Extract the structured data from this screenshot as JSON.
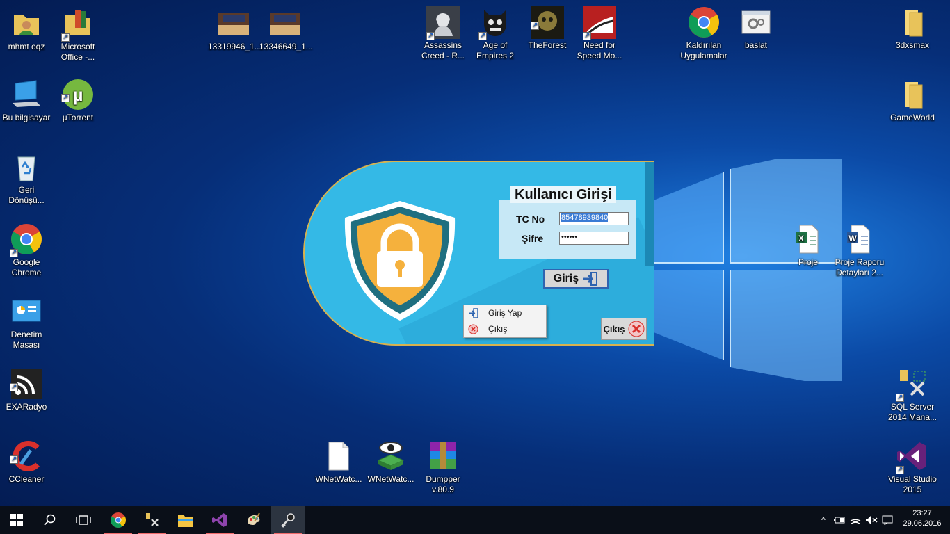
{
  "desktop": {
    "icons": [
      {
        "label": "mhmt oqz",
        "icon": "user-folder-icon"
      },
      {
        "label": "Microsoft Office -...",
        "icon": "office-folder-icon"
      },
      {
        "label": "13319946_1...",
        "icon": "image-thumbnail-icon"
      },
      {
        "label": "13346649_1...",
        "icon": "image-thumbnail-icon"
      },
      {
        "label": "Assassins Creed - R...",
        "icon": "game-icon"
      },
      {
        "label": "Age of Empires 2",
        "icon": "game-icon"
      },
      {
        "label": "TheForest",
        "icon": "game-icon"
      },
      {
        "label": "Need for Speed Mo...",
        "icon": "game-icon"
      },
      {
        "label": "Kaldırılan Uygulamalar",
        "icon": "chrome-icon"
      },
      {
        "label": "baslat",
        "icon": "settings-file-icon"
      },
      {
        "label": "3dxsmax",
        "icon": "folder-icon"
      },
      {
        "label": "Bu bilgisayar",
        "icon": "computer-icon"
      },
      {
        "label": "µTorrent",
        "icon": "utorrent-icon"
      },
      {
        "label": "GameWorld",
        "icon": "folder-icon"
      },
      {
        "label": "Geri Dönüşü...",
        "icon": "recycle-bin-icon"
      },
      {
        "label": "Google Chrome",
        "icon": "chrome-icon"
      },
      {
        "label": "Proje",
        "icon": "excel-file-icon"
      },
      {
        "label": "Proje Raporu Detayları 2...",
        "icon": "word-file-icon"
      },
      {
        "label": "Denetim Masası",
        "icon": "control-panel-icon"
      },
      {
        "label": "EXARadyo",
        "icon": "radio-icon"
      },
      {
        "label": "SQL Server 2014 Mana...",
        "icon": "sql-server-icon"
      },
      {
        "label": "CCleaner",
        "icon": "ccleaner-icon"
      },
      {
        "label": "WNetWatc...",
        "icon": "blank-file-icon"
      },
      {
        "label": "WNetWatc...",
        "icon": "network-watcher-icon"
      },
      {
        "label": "Dumpper v.80.9",
        "icon": "winrar-icon"
      },
      {
        "label": "Visual Studio 2015",
        "icon": "visual-studio-icon"
      }
    ]
  },
  "login": {
    "title": "Kullanıcı Girişi",
    "tc_label": "TC No",
    "tc_value": "85478939840",
    "pass_label": "Şifre",
    "pass_value": "••••••",
    "login_button": "Giriş",
    "exit_button": "Çıkış"
  },
  "context_menu": {
    "items": [
      {
        "label": "Giriş Yap",
        "icon": "login-icon"
      },
      {
        "label": "Çıkış",
        "icon": "close-icon"
      }
    ]
  },
  "taskbar": {
    "clock_time": "23:27",
    "clock_date": "29.06.2016"
  },
  "colors": {
    "login_bg": "#34b9e6",
    "shield_orange": "#f5b13d",
    "shield_teal": "#1f6f80",
    "accent_blue": "#2f64b0"
  }
}
